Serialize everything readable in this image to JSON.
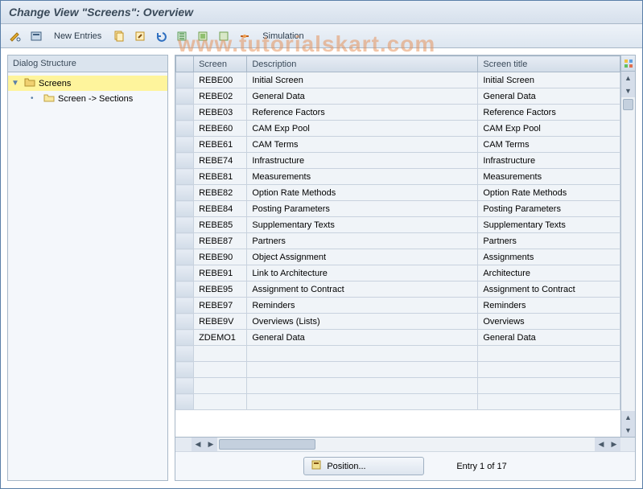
{
  "title": "Change View \"Screens\": Overview",
  "watermark": "www.tutorialskart.com",
  "toolbar": {
    "new_entries": "New Entries",
    "simulation": "Simulation"
  },
  "tree": {
    "header": "Dialog Structure",
    "root": "Screens",
    "child": "Screen -> Sections"
  },
  "grid": {
    "columns": {
      "screen": "Screen",
      "description": "Description",
      "title": "Screen title"
    },
    "rows": [
      {
        "screen": "REBE00",
        "description": "Initial Screen",
        "title": "Initial Screen"
      },
      {
        "screen": "REBE02",
        "description": "General Data",
        "title": "General Data"
      },
      {
        "screen": "REBE03",
        "description": "Reference Factors",
        "title": "Reference Factors"
      },
      {
        "screen": "REBE60",
        "description": "CAM Exp Pool",
        "title": "CAM Exp Pool"
      },
      {
        "screen": "REBE61",
        "description": "CAM Terms",
        "title": "CAM Terms"
      },
      {
        "screen": "REBE74",
        "description": "Infrastructure",
        "title": "Infrastructure"
      },
      {
        "screen": "REBE81",
        "description": "Measurements",
        "title": "Measurements"
      },
      {
        "screen": "REBE82",
        "description": "Option Rate Methods",
        "title": "Option Rate Methods"
      },
      {
        "screen": "REBE84",
        "description": "Posting Parameters",
        "title": "Posting Parameters"
      },
      {
        "screen": "REBE85",
        "description": "Supplementary Texts",
        "title": "Supplementary Texts"
      },
      {
        "screen": "REBE87",
        "description": "Partners",
        "title": "Partners"
      },
      {
        "screen": "REBE90",
        "description": "Object Assignment",
        "title": "Assignments"
      },
      {
        "screen": "REBE91",
        "description": "Link to Architecture",
        "title": "Architecture"
      },
      {
        "screen": "REBE95",
        "description": "Assignment to Contract",
        "title": "Assignment to Contract"
      },
      {
        "screen": "REBE97",
        "description": "Reminders",
        "title": "Reminders"
      },
      {
        "screen": "REBE9V",
        "description": "Overviews (Lists)",
        "title": "Overviews"
      },
      {
        "screen": "ZDEMO1",
        "description": "General Data",
        "title": "General Data"
      }
    ],
    "empty_rows": 4
  },
  "footer": {
    "position_label": "Position...",
    "entry_text": "Entry 1 of 17"
  },
  "icons": {
    "pencil": "pencil-glasses-icon",
    "other": "other-view-icon",
    "copy": "copy-icon",
    "paste": "change-icon",
    "undo": "undo-icon",
    "delete": "delete-icon",
    "select_all": "select-all-icon",
    "deselect": "deselect-all-icon",
    "bc": "bc-set-icon"
  }
}
